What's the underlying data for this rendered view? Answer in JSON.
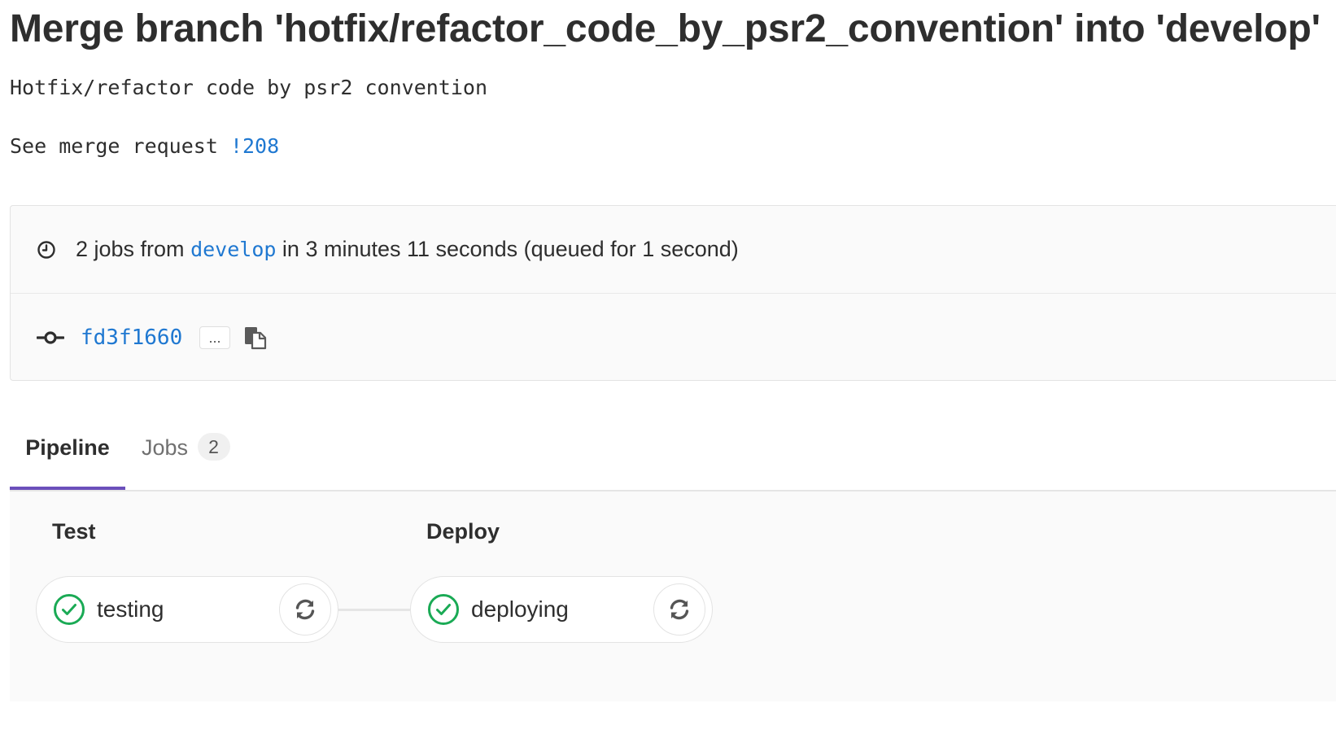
{
  "commit": {
    "title": "Merge branch 'hotfix/refactor_code_by_psr2_convention' into 'develop'",
    "description_line1": "Hotfix/refactor code by psr2 convention",
    "description_line2_prefix": "See merge request ",
    "merge_request_link": "!208"
  },
  "info": {
    "icon": "clock-icon",
    "jobs_prefix": "2 jobs from ",
    "branch": "develop",
    "jobs_suffix": " in 3 minutes 11 seconds (queued for 1 second)",
    "commit_icon": "commit-icon",
    "sha": "fd3f1660",
    "ellipsis_label": "...",
    "copy_icon": "clipboard-icon"
  },
  "tabs": {
    "pipeline_label": "Pipeline",
    "jobs_label": "Jobs",
    "jobs_count": "2",
    "active_color": "#6b4fbb"
  },
  "pipeline": {
    "stages": [
      {
        "title": "Test",
        "job": {
          "name": "testing",
          "status": "success",
          "status_icon": "check-circle-icon",
          "action_icon": "retry-icon"
        }
      },
      {
        "title": "Deploy",
        "job": {
          "name": "deploying",
          "status": "success",
          "status_icon": "check-circle-icon",
          "action_icon": "retry-icon"
        }
      }
    ],
    "success_color": "#1aaa55",
    "link_color": "#1f78d1"
  }
}
